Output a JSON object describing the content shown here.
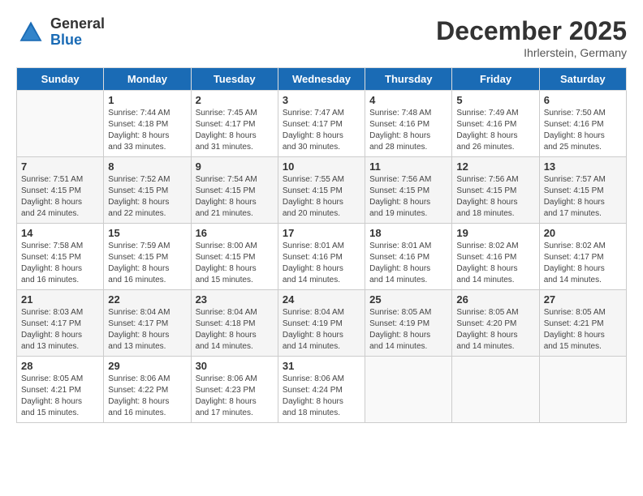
{
  "header": {
    "logo_general": "General",
    "logo_blue": "Blue",
    "month": "December 2025",
    "location": "Ihrlerstein, Germany"
  },
  "weekdays": [
    "Sunday",
    "Monday",
    "Tuesday",
    "Wednesday",
    "Thursday",
    "Friday",
    "Saturday"
  ],
  "weeks": [
    [
      {
        "day": "",
        "info": ""
      },
      {
        "day": "1",
        "info": "Sunrise: 7:44 AM\nSunset: 4:18 PM\nDaylight: 8 hours\nand 33 minutes."
      },
      {
        "day": "2",
        "info": "Sunrise: 7:45 AM\nSunset: 4:17 PM\nDaylight: 8 hours\nand 31 minutes."
      },
      {
        "day": "3",
        "info": "Sunrise: 7:47 AM\nSunset: 4:17 PM\nDaylight: 8 hours\nand 30 minutes."
      },
      {
        "day": "4",
        "info": "Sunrise: 7:48 AM\nSunset: 4:16 PM\nDaylight: 8 hours\nand 28 minutes."
      },
      {
        "day": "5",
        "info": "Sunrise: 7:49 AM\nSunset: 4:16 PM\nDaylight: 8 hours\nand 26 minutes."
      },
      {
        "day": "6",
        "info": "Sunrise: 7:50 AM\nSunset: 4:16 PM\nDaylight: 8 hours\nand 25 minutes."
      }
    ],
    [
      {
        "day": "7",
        "info": "Sunrise: 7:51 AM\nSunset: 4:15 PM\nDaylight: 8 hours\nand 24 minutes."
      },
      {
        "day": "8",
        "info": "Sunrise: 7:52 AM\nSunset: 4:15 PM\nDaylight: 8 hours\nand 22 minutes."
      },
      {
        "day": "9",
        "info": "Sunrise: 7:54 AM\nSunset: 4:15 PM\nDaylight: 8 hours\nand 21 minutes."
      },
      {
        "day": "10",
        "info": "Sunrise: 7:55 AM\nSunset: 4:15 PM\nDaylight: 8 hours\nand 20 minutes."
      },
      {
        "day": "11",
        "info": "Sunrise: 7:56 AM\nSunset: 4:15 PM\nDaylight: 8 hours\nand 19 minutes."
      },
      {
        "day": "12",
        "info": "Sunrise: 7:56 AM\nSunset: 4:15 PM\nDaylight: 8 hours\nand 18 minutes."
      },
      {
        "day": "13",
        "info": "Sunrise: 7:57 AM\nSunset: 4:15 PM\nDaylight: 8 hours\nand 17 minutes."
      }
    ],
    [
      {
        "day": "14",
        "info": "Sunrise: 7:58 AM\nSunset: 4:15 PM\nDaylight: 8 hours\nand 16 minutes."
      },
      {
        "day": "15",
        "info": "Sunrise: 7:59 AM\nSunset: 4:15 PM\nDaylight: 8 hours\nand 16 minutes."
      },
      {
        "day": "16",
        "info": "Sunrise: 8:00 AM\nSunset: 4:15 PM\nDaylight: 8 hours\nand 15 minutes."
      },
      {
        "day": "17",
        "info": "Sunrise: 8:01 AM\nSunset: 4:16 PM\nDaylight: 8 hours\nand 14 minutes."
      },
      {
        "day": "18",
        "info": "Sunrise: 8:01 AM\nSunset: 4:16 PM\nDaylight: 8 hours\nand 14 minutes."
      },
      {
        "day": "19",
        "info": "Sunrise: 8:02 AM\nSunset: 4:16 PM\nDaylight: 8 hours\nand 14 minutes."
      },
      {
        "day": "20",
        "info": "Sunrise: 8:02 AM\nSunset: 4:17 PM\nDaylight: 8 hours\nand 14 minutes."
      }
    ],
    [
      {
        "day": "21",
        "info": "Sunrise: 8:03 AM\nSunset: 4:17 PM\nDaylight: 8 hours\nand 13 minutes."
      },
      {
        "day": "22",
        "info": "Sunrise: 8:04 AM\nSunset: 4:17 PM\nDaylight: 8 hours\nand 13 minutes."
      },
      {
        "day": "23",
        "info": "Sunrise: 8:04 AM\nSunset: 4:18 PM\nDaylight: 8 hours\nand 14 minutes."
      },
      {
        "day": "24",
        "info": "Sunrise: 8:04 AM\nSunset: 4:19 PM\nDaylight: 8 hours\nand 14 minutes."
      },
      {
        "day": "25",
        "info": "Sunrise: 8:05 AM\nSunset: 4:19 PM\nDaylight: 8 hours\nand 14 minutes."
      },
      {
        "day": "26",
        "info": "Sunrise: 8:05 AM\nSunset: 4:20 PM\nDaylight: 8 hours\nand 14 minutes."
      },
      {
        "day": "27",
        "info": "Sunrise: 8:05 AM\nSunset: 4:21 PM\nDaylight: 8 hours\nand 15 minutes."
      }
    ],
    [
      {
        "day": "28",
        "info": "Sunrise: 8:05 AM\nSunset: 4:21 PM\nDaylight: 8 hours\nand 15 minutes."
      },
      {
        "day": "29",
        "info": "Sunrise: 8:06 AM\nSunset: 4:22 PM\nDaylight: 8 hours\nand 16 minutes."
      },
      {
        "day": "30",
        "info": "Sunrise: 8:06 AM\nSunset: 4:23 PM\nDaylight: 8 hours\nand 17 minutes."
      },
      {
        "day": "31",
        "info": "Sunrise: 8:06 AM\nSunset: 4:24 PM\nDaylight: 8 hours\nand 18 minutes."
      },
      {
        "day": "",
        "info": ""
      },
      {
        "day": "",
        "info": ""
      },
      {
        "day": "",
        "info": ""
      }
    ]
  ]
}
